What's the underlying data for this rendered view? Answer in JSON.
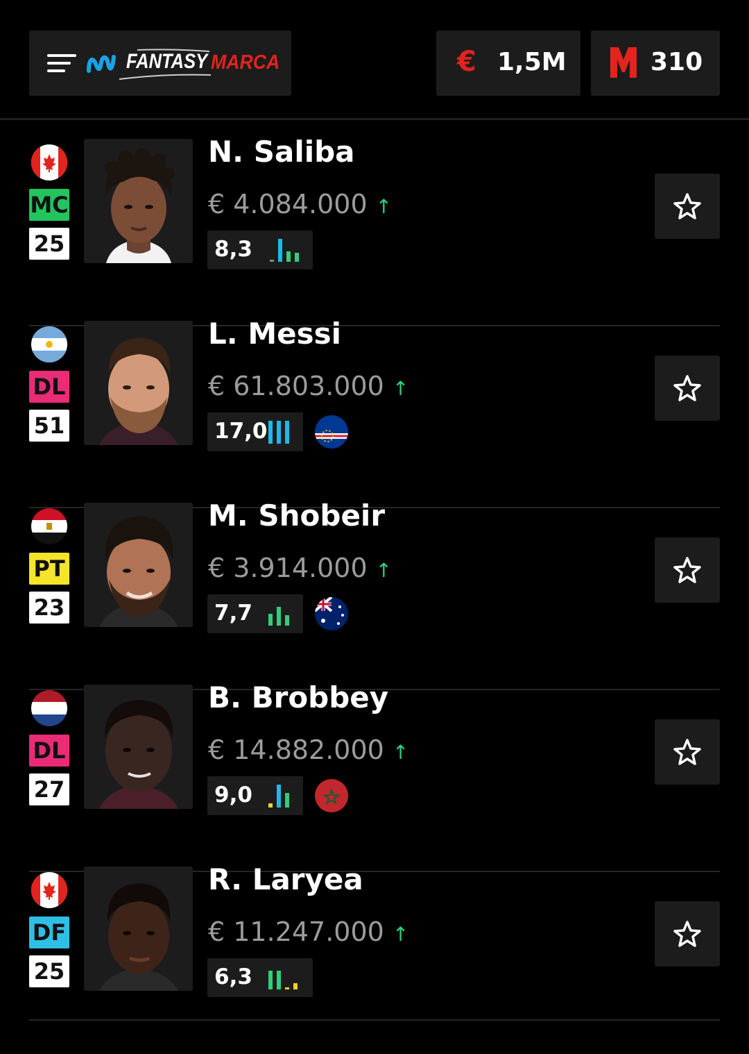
{
  "header": {
    "brand_fantasy": "FANTASY",
    "brand_marca": "MARCA",
    "money_symbol": "€",
    "money_value": "1,5M",
    "points_value": "310"
  },
  "players": [
    {
      "name": "N. Saliba",
      "nation_flag": "canada-flag",
      "position": "MC",
      "age": "25",
      "price": "€ 4.084.000",
      "trend": "↑",
      "rating": "8,3",
      "form_bars": [
        "low",
        "high",
        "mid",
        "mid"
      ],
      "team_flag": null
    },
    {
      "name": "L. Messi",
      "nation_flag": "argentina-flag",
      "position": "DL",
      "age": "51",
      "price": "€ 61.803.000",
      "trend": "↑",
      "rating": "17,0",
      "form_bars": [
        "high",
        "high",
        "high"
      ],
      "team_flag": "cape-verde-flag"
    },
    {
      "name": "M. Shobeir",
      "nation_flag": "egypt-flag",
      "position": "PT",
      "age": "23",
      "price": "€ 3.914.000",
      "trend": "↑",
      "rating": "7,7",
      "form_bars": [
        "mid",
        "high",
        "mid"
      ],
      "team_flag": "australia-flag"
    },
    {
      "name": "B. Brobbey",
      "nation_flag": "netherlands-flag",
      "position": "DL",
      "age": "27",
      "price": "€ 14.882.000",
      "trend": "↑",
      "rating": "9,0",
      "form_bars": [
        "low",
        "high",
        "mid"
      ],
      "team_flag": "morocco-flag"
    },
    {
      "name": "R. Laryea",
      "nation_flag": "canada-flag",
      "position": "DF",
      "age": "25",
      "price": "€ 11.247.000",
      "trend": "↑",
      "rating": "6,3",
      "form_bars": [
        "high",
        "high",
        "low",
        "low"
      ],
      "team_flag": null
    }
  ],
  "colors": {
    "accent_red": "#e4231e",
    "trend_green": "#2ed07b",
    "pos_mc": "#23c35e",
    "pos_dl": "#ea2b75",
    "pos_pt": "#f4e52a",
    "pos_df": "#2fbfe6",
    "bar_blue": "#1fb8e8",
    "bar_green": "#2ed07b",
    "bar_yellow": "#f1d22b"
  }
}
